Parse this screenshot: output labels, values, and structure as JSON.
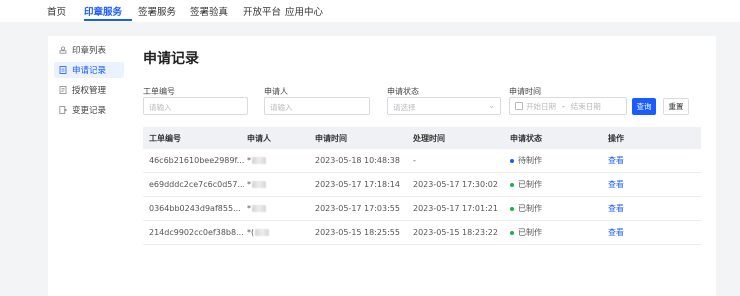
{
  "topnav": {
    "items": [
      "首页",
      "印章服务",
      "签署服务",
      "签署验真",
      "开放平台",
      "应用中心"
    ],
    "active_index": 1
  },
  "sidebar": {
    "items": [
      {
        "label": "印章列表",
        "icon": "seal-icon"
      },
      {
        "label": "申请记录",
        "icon": "document-icon"
      },
      {
        "label": "授权管理",
        "icon": "authorization-icon"
      },
      {
        "label": "变更记录",
        "icon": "change-record-icon"
      }
    ],
    "active_index": 1
  },
  "page": {
    "title": "申请记录"
  },
  "filters": {
    "order_no": {
      "label": "工单编号",
      "placeholder": "请输入"
    },
    "applicant": {
      "label": "申请人",
      "placeholder": "请输入"
    },
    "status": {
      "label": "申请状态",
      "placeholder": "请选择"
    },
    "time": {
      "label": "申请时间",
      "start_placeholder": "开始日期",
      "separator": "-",
      "end_placeholder": "结束日期"
    },
    "query_label": "查询",
    "reset_label": "重置"
  },
  "table": {
    "headers": [
      "工单编号",
      "申请人",
      "申请时间",
      "处理时间",
      "申请状态",
      "操作"
    ],
    "rows": [
      {
        "order_no": "46c6b21610bee2989f...",
        "applicant": "*",
        "apply_time": "2023-05-18 10:48:38",
        "process_time": "-",
        "status": "待制作",
        "status_color": "#1a5cff",
        "action": "查看"
      },
      {
        "order_no": "e69dddc2ce7c6c0d57...",
        "applicant": "*",
        "apply_time": "2023-05-17 17:18:14",
        "process_time": "2023-05-17 17:30:02",
        "status": "已制作",
        "status_color": "#18b24b",
        "action": "查看"
      },
      {
        "order_no": "0364bb0243d9af855...",
        "applicant": "*",
        "apply_time": "2023-05-17 17:03:55",
        "process_time": "2023-05-17 17:01:21",
        "status": "已制作",
        "status_color": "#18b24b",
        "action": "查看"
      },
      {
        "order_no": "214dc9902cc0ef38b8...",
        "applicant": "*(",
        "apply_time": "2023-05-15 18:25:55",
        "process_time": "2023-05-15 18:23:22",
        "status": "已制作",
        "status_color": "#18b24b",
        "action": "查看"
      }
    ]
  }
}
